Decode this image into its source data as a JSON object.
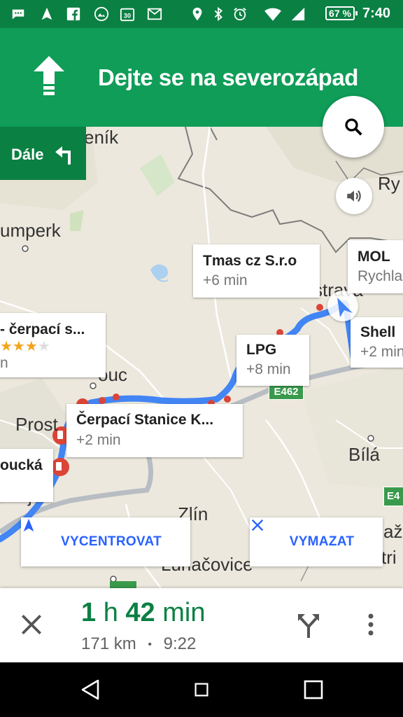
{
  "status_bar": {
    "battery": "67 %",
    "time": "7:40",
    "calendar_day": "30"
  },
  "navigation": {
    "instruction": "Dejte se na severozápad",
    "then_label": "Dále"
  },
  "map": {
    "towns": {
      "sumperk": "umperk",
      "olomouc": "ouc",
      "prostejov": "Prost",
      "kojov": "jov",
      "zlin": "Zlín",
      "luhacovice": "Luhačovice",
      "bila": "Bílá",
      "ryc": "Ry",
      "vazs": "až",
      "stri": "tri",
      "ostrava": "strava",
      "yenik": "eník"
    },
    "road_shields": [
      "E462",
      "E4"
    ],
    "callouts": [
      {
        "title": "Tmas cz S.r.o",
        "sub": "+6 min"
      },
      {
        "title": "MOL",
        "sub": "Rychla"
      },
      {
        "title": "Shell",
        "sub": "+2 min"
      },
      {
        "title": "- čerpací s...",
        "sub": "n",
        "rating": "★★★"
      },
      {
        "title": "LPG",
        "sub": "+8 min"
      },
      {
        "title": "Čerpací Stanice K...",
        "sub": "+2 min"
      },
      {
        "title": "oucká",
        "sub": ""
      }
    ],
    "recenter_label": "VYCENTROVAT",
    "clear_label": "VYMAZAT"
  },
  "trip": {
    "duration_hours": "1",
    "duration_h_unit": "h",
    "duration_minutes": "42",
    "duration_min_unit": "min",
    "distance": "171 km",
    "separator": "•",
    "arrival": "9:22"
  },
  "colors": {
    "status_bar": "#0b8043",
    "banner": "#0f9d58",
    "route": "#4285f4",
    "accent_blue": "#2962ff"
  }
}
